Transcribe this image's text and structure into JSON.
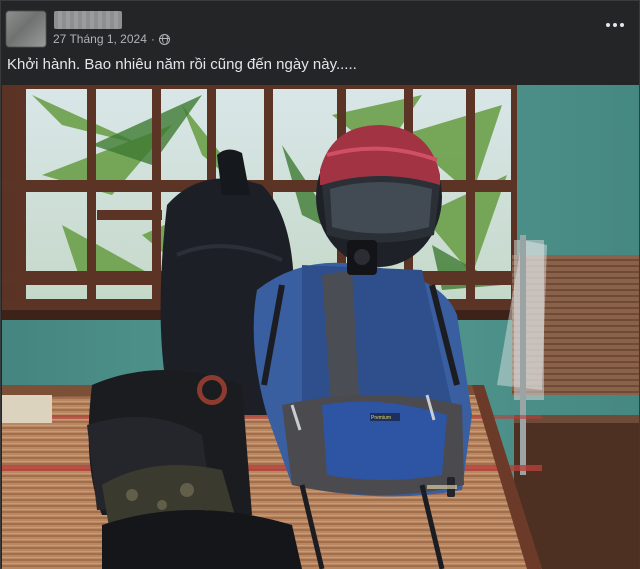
{
  "post": {
    "author_name": "",
    "date": "27 Tháng 1, 2024",
    "separator": "·",
    "privacy_icon": "globe-icon",
    "more_icon": "more-horizontal-icon",
    "caption": "Khởi hành. Bao nhiêu năm rồi cũng đến ngày này.....",
    "photo_text": "Premium",
    "colors": {
      "background": "#242526",
      "text_primary": "#e4e6eb",
      "text_secondary": "#b0b3b8"
    }
  }
}
